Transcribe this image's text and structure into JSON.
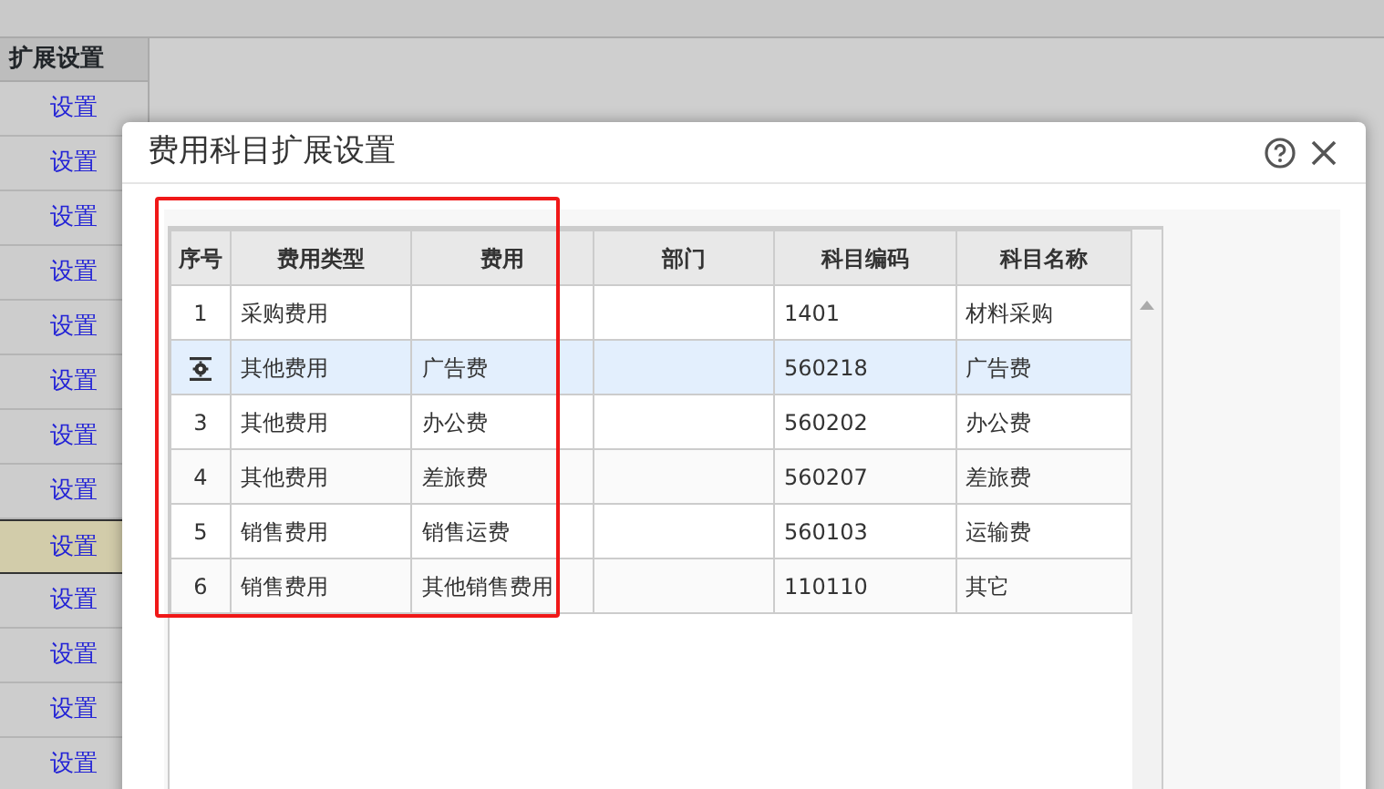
{
  "background_page": {
    "column_header": "扩展设置",
    "rows": [
      {
        "label": "设置",
        "selected": false
      },
      {
        "label": "设置",
        "selected": false
      },
      {
        "label": "设置",
        "selected": false
      },
      {
        "label": "设置",
        "selected": false
      },
      {
        "label": "设置",
        "selected": false
      },
      {
        "label": "设置",
        "selected": false
      },
      {
        "label": "设置",
        "selected": false
      },
      {
        "label": "设置",
        "selected": false
      },
      {
        "label": "设置",
        "selected": true
      },
      {
        "label": "设置",
        "selected": false
      },
      {
        "label": "设置",
        "selected": false
      },
      {
        "label": "设置",
        "selected": false
      },
      {
        "label": "设置",
        "selected": false
      }
    ]
  },
  "dialog": {
    "title": "费用科目扩展设置",
    "table": {
      "columns": [
        "序号",
        "费用类型",
        "费用",
        "部门",
        "科目编码",
        "科目名称"
      ],
      "rows": [
        {
          "kind": "number",
          "cells": [
            "1",
            "采购费用",
            "",
            "",
            "1401",
            "材料采购"
          ],
          "selected": false
        },
        {
          "kind": "settings",
          "cells": [
            "",
            "其他费用",
            "广告费",
            "",
            "560218",
            "广告费"
          ],
          "selected": true
        },
        {
          "kind": "number",
          "cells": [
            "3",
            "其他费用",
            "办公费",
            "",
            "560202",
            "办公费"
          ],
          "selected": false
        },
        {
          "kind": "number",
          "cells": [
            "4",
            "其他费用",
            "差旅费",
            "",
            "560207",
            "差旅费"
          ],
          "selected": false
        },
        {
          "kind": "number",
          "cells": [
            "5",
            "销售费用",
            "销售运费",
            "",
            "560103",
            "运输费"
          ],
          "selected": false
        },
        {
          "kind": "number",
          "cells": [
            "6",
            "销售费用",
            "其他销售费用",
            "",
            "110110",
            "其它"
          ],
          "selected": false
        }
      ]
    }
  }
}
